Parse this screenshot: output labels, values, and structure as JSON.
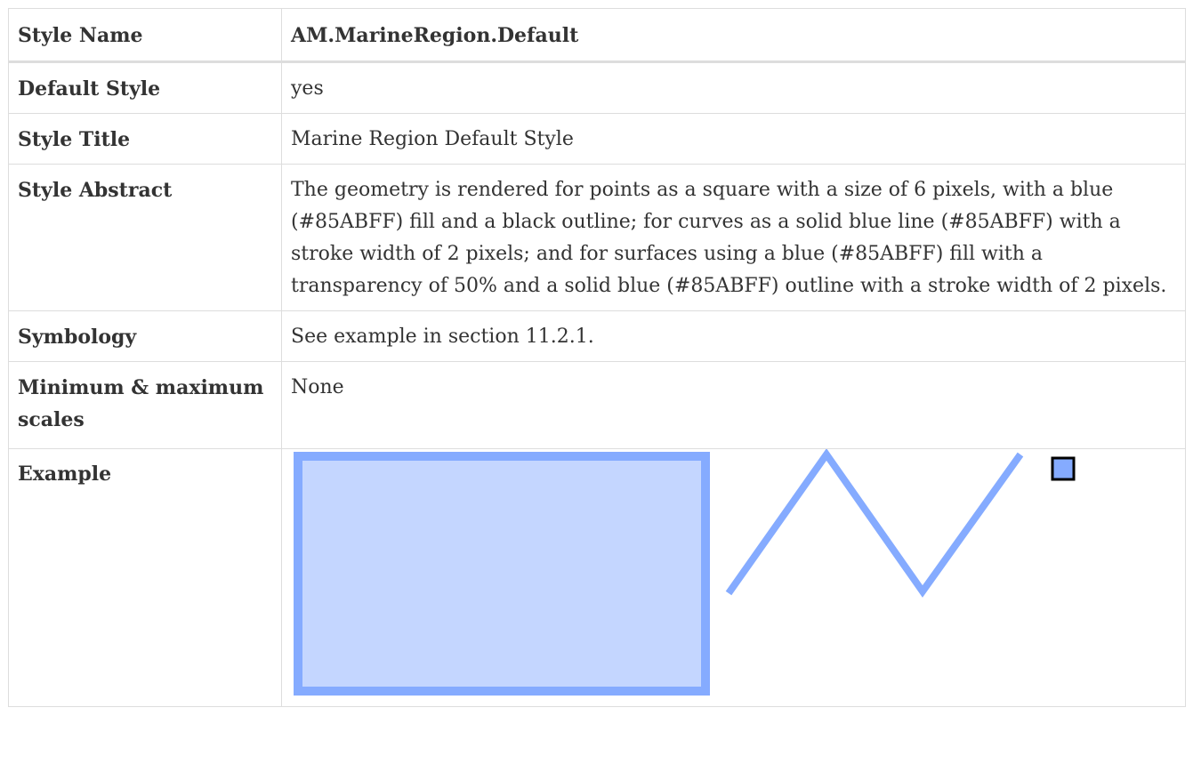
{
  "table": {
    "rows": [
      {
        "key": "Style Name",
        "value": "AM.MarineRegion.Default"
      },
      {
        "key": "Default Style",
        "value": "yes"
      },
      {
        "key": "Style Title",
        "value": "Marine Region Default Style"
      },
      {
        "key": "Style Abstract",
        "value": "The geometry is rendered for points as a square with a size of 6 pixels, with a blue (#85ABFF) fill and a black outline; for curves as a solid blue line (#85ABFF) with a stroke width of 2 pixels; and for surfaces using a blue (#85ABFF) fill with a transparency of 50% and a solid blue (#85ABFF) outline with a stroke width of 2 pixels."
      },
      {
        "key": "Symbology",
        "value": "See example in section 11.2.1."
      },
      {
        "key": "Minimum & maximum scales",
        "value": "None"
      },
      {
        "key": "Example",
        "value": ""
      }
    ]
  },
  "example": {
    "stroke_color": "#85ABFF",
    "fill_color": "#C4D6FF",
    "point_fill": "#85ABFF",
    "point_outline": "#000000",
    "surface_fill_opacity": 0.5
  }
}
